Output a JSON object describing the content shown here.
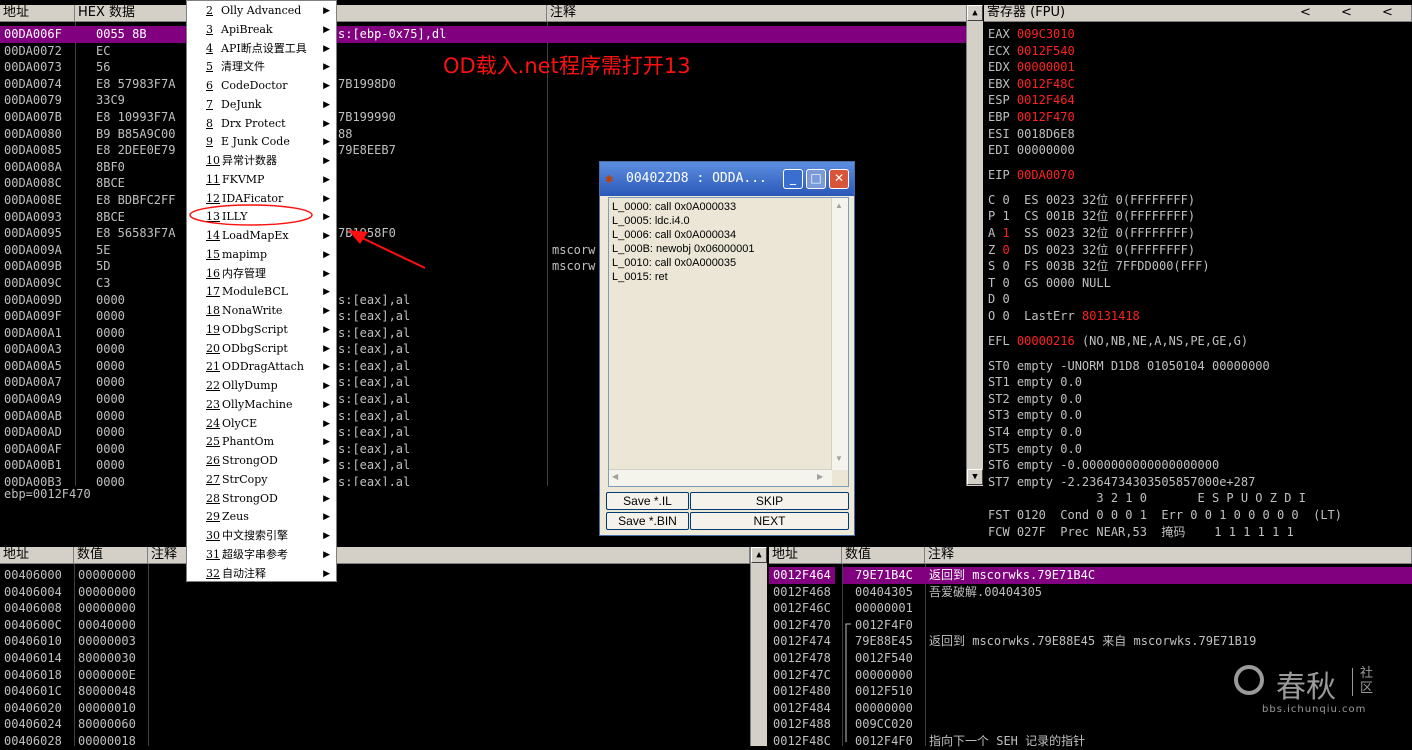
{
  "disasm": {
    "headers": {
      "addr": "地址",
      "hex": "HEX 数据",
      "disasm": "",
      "comment": "注释"
    },
    "rows": [
      {
        "addr": "00DA006F",
        "hex": "0055 8B",
        "asm": "s:[ebp-0x75],dl",
        "cmt": "",
        "sel": true
      },
      {
        "addr": "00DA0072",
        "hex": "EC",
        "asm": "",
        "cmt": ""
      },
      {
        "addr": "00DA0073",
        "hex": "56",
        "asm": "",
        "cmt": ""
      },
      {
        "addr": "00DA0074",
        "hex": "E8 57983F7A",
        "asm": "7B1998D0",
        "cmt": ""
      },
      {
        "addr": "00DA0079",
        "hex": "33C9",
        "asm": "",
        "cmt": ""
      },
      {
        "addr": "00DA007B",
        "hex": "E8 10993F7A",
        "asm": "7B199990",
        "cmt": ""
      },
      {
        "addr": "00DA0080",
        "hex": "B9 B85A9C00",
        "asm": "88",
        "cmt": ""
      },
      {
        "addr": "00DA0085",
        "hex": "E8 2DEE0E79",
        "asm": "79E8EEB7",
        "cmt": ""
      },
      {
        "addr": "00DA008A",
        "hex": "8BF0",
        "asm": "",
        "cmt": ""
      },
      {
        "addr": "00DA008C",
        "hex": "8BCE",
        "asm": "",
        "cmt": ""
      },
      {
        "addr": "00DA008E",
        "hex": "E8 BDBFC2FF",
        "asm": "",
        "cmt": ""
      },
      {
        "addr": "00DA0093",
        "hex": "8BCE",
        "asm": "",
        "cmt": ""
      },
      {
        "addr": "00DA0095",
        "hex": "E8 56583F7A",
        "asm": "7B1958F0",
        "cmt": ""
      },
      {
        "addr": "00DA009A",
        "hex": "5E",
        "asm": "",
        "cmt": "mscorw"
      },
      {
        "addr": "00DA009B",
        "hex": "5D",
        "asm": "",
        "cmt": "mscorw"
      },
      {
        "addr": "00DA009C",
        "hex": "C3",
        "asm": "",
        "cmt": ""
      },
      {
        "addr": "00DA009D",
        "hex": "0000",
        "asm": "s:[eax],al",
        "cmt": ""
      },
      {
        "addr": "00DA009F",
        "hex": "0000",
        "asm": "s:[eax],al",
        "cmt": ""
      },
      {
        "addr": "00DA00A1",
        "hex": "0000",
        "asm": "s:[eax],al",
        "cmt": ""
      },
      {
        "addr": "00DA00A3",
        "hex": "0000",
        "asm": "s:[eax],al",
        "cmt": ""
      },
      {
        "addr": "00DA00A5",
        "hex": "0000",
        "asm": "s:[eax],al",
        "cmt": ""
      },
      {
        "addr": "00DA00A7",
        "hex": "0000",
        "asm": "s:[eax],al",
        "cmt": ""
      },
      {
        "addr": "00DA00A9",
        "hex": "0000",
        "asm": "s:[eax],al",
        "cmt": ""
      },
      {
        "addr": "00DA00AB",
        "hex": "0000",
        "asm": "s:[eax],al",
        "cmt": ""
      },
      {
        "addr": "00DA00AD",
        "hex": "0000",
        "asm": "s:[eax],al",
        "cmt": ""
      },
      {
        "addr": "00DA00AF",
        "hex": "0000",
        "asm": "s:[eax],al",
        "cmt": ""
      },
      {
        "addr": "00DA00B1",
        "hex": "0000",
        "asm": "s:[eax],al",
        "cmt": ""
      },
      {
        "addr": "00DA00B3",
        "hex": "0000",
        "asm": "s:[eax],al",
        "cmt": ""
      }
    ],
    "info_line": "ebp=0012F470"
  },
  "overlay_text": "OD载入.net程序需打开13",
  "menu": {
    "items": [
      {
        "num": "2",
        "label": "Olly Advanced"
      },
      {
        "num": "3",
        "label": "ApiBreak"
      },
      {
        "num": "4",
        "label": "API断点设置工具"
      },
      {
        "num": "5",
        "label": "清理文件"
      },
      {
        "num": "6",
        "label": "CodeDoctor"
      },
      {
        "num": "7",
        "label": "DeJunk"
      },
      {
        "num": "8",
        "label": "Drx Protect"
      },
      {
        "num": "9",
        "label": "E Junk Code"
      },
      {
        "num": "10",
        "label": "异常计数器"
      },
      {
        "num": "11",
        "label": "FKVMP"
      },
      {
        "num": "12",
        "label": "IDAFicator"
      },
      {
        "num": "13",
        "label": "ILLY"
      },
      {
        "num": "14",
        "label": "LoadMapEx"
      },
      {
        "num": "15",
        "label": "mapimp"
      },
      {
        "num": "16",
        "label": "内存管理"
      },
      {
        "num": "17",
        "label": "ModuleBCL"
      },
      {
        "num": "18",
        "label": "NonaWrite"
      },
      {
        "num": "19",
        "label": "ODbgScript"
      },
      {
        "num": "20",
        "label": "ODbgScript"
      },
      {
        "num": "21",
        "label": "ODDragAttach"
      },
      {
        "num": "22",
        "label": "OllyDump"
      },
      {
        "num": "23",
        "label": "OllyMachine"
      },
      {
        "num": "24",
        "label": "OlyCE"
      },
      {
        "num": "25",
        "label": "PhantOm"
      },
      {
        "num": "26",
        "label": "StrongOD"
      },
      {
        "num": "27",
        "label": "StrCopy"
      },
      {
        "num": "28",
        "label": "StrongOD"
      },
      {
        "num": "29",
        "label": "Zeus"
      },
      {
        "num": "30",
        "label": "中文搜索引擎"
      },
      {
        "num": "31",
        "label": "超级字串参考"
      },
      {
        "num": "32",
        "label": "自动注释"
      }
    ],
    "arrow": "▶"
  },
  "registers": {
    "title": "寄存器 (FPU)",
    "nav": [
      "<",
      "<",
      "<"
    ],
    "gp": [
      {
        "name": "EAX",
        "val": "009C3010",
        "red": true
      },
      {
        "name": "ECX",
        "val": "0012F540",
        "red": true
      },
      {
        "name": "EDX",
        "val": "00000001",
        "red": true
      },
      {
        "name": "EBX",
        "val": "0012F48C",
        "red": true
      },
      {
        "name": "ESP",
        "val": "0012F464",
        "red": true
      },
      {
        "name": "EBP",
        "val": "0012F470",
        "red": true
      },
      {
        "name": "ESI",
        "val": "0018D6E8",
        "red": false
      },
      {
        "name": "EDI",
        "val": "00000000",
        "red": false
      }
    ],
    "eip": {
      "name": "EIP",
      "val": "00DA0070"
    },
    "flags": [
      {
        "f": "C",
        "v": "0",
        "seg": "ES 0023 32位 0(FFFFFFFF)",
        "red": false
      },
      {
        "f": "P",
        "v": "1",
        "seg": "CS 001B 32位 0(FFFFFFFF)",
        "red": false
      },
      {
        "f": "A",
        "v": "1",
        "seg": "SS 0023 32位 0(FFFFFFFF)",
        "red": true
      },
      {
        "f": "Z",
        "v": "0",
        "seg": "DS 0023 32位 0(FFFFFFFF)",
        "red": true
      },
      {
        "f": "S",
        "v": "0",
        "seg": "FS 003B 32位 7FFDD000(FFF)",
        "red": false
      },
      {
        "f": "T",
        "v": "0",
        "seg": "GS 0000 NULL",
        "red": false
      },
      {
        "f": "D",
        "v": "0",
        "seg": "",
        "red": false
      },
      {
        "f": "O",
        "v": "0",
        "seg": "LastErr",
        "red": false
      }
    ],
    "lasterr_val": "80131418",
    "efl_label": "EFL",
    "efl_val": "00000216",
    "efl_desc": "(NO,NB,NE,A,NS,PE,GE,G)",
    "st": [
      "ST0 empty -UNORM D1D8 01050104 00000000",
      "ST1 empty 0.0",
      "ST2 empty 0.0",
      "ST3 empty 0.0",
      "ST4 empty 0.0",
      "ST5 empty 0.0",
      "ST6 empty -0.0000000000000000000",
      "ST7 empty -2.2364734303505857000e+287"
    ],
    "bits_header": "               3 2 1 0       E S P U O Z D I",
    "fst": "FST 0120  Cond 0 0 0 1  Err 0 0 1 0 0 0 0 0  (LT)",
    "fcw": "FCW 027F  Prec NEAR,53  掩码    1 1 1 1 1 1"
  },
  "dump": {
    "headers": {
      "addr": "地址",
      "val": "数值",
      "cmt": "注释"
    },
    "rows": [
      {
        "addr": "00406000",
        "val": "00000000"
      },
      {
        "addr": "00406004",
        "val": "00000000"
      },
      {
        "addr": "00406008",
        "val": "00000000"
      },
      {
        "addr": "0040600C",
        "val": "00040000"
      },
      {
        "addr": "00406010",
        "val": "00000003"
      },
      {
        "addr": "00406014",
        "val": "80000030"
      },
      {
        "addr": "00406018",
        "val": "0000000E"
      },
      {
        "addr": "0040601C",
        "val": "80000048"
      },
      {
        "addr": "00406020",
        "val": "00000010"
      },
      {
        "addr": "00406024",
        "val": "80000060"
      },
      {
        "addr": "00406028",
        "val": "00000018"
      }
    ]
  },
  "stack": {
    "headers": {
      "addr": "地址",
      "val": "数值",
      "cmt": "注释"
    },
    "rows": [
      {
        "addr": "0012F464",
        "val": "79E71B4C",
        "cmt": "返回到 mscorwks.79E71B4C",
        "sel": true
      },
      {
        "addr": "0012F468",
        "val": "00404305",
        "cmt": "吾爱破解.00404305"
      },
      {
        "addr": "0012F46C",
        "val": "00000001",
        "cmt": ""
      },
      {
        "addr": "0012F470",
        "val": "0012F4F0",
        "cmt": ""
      },
      {
        "addr": "0012F474",
        "val": "79E88E45",
        "cmt": "返回到 mscorwks.79E88E45 来自 mscorwks.79E71B19"
      },
      {
        "addr": "0012F478",
        "val": "0012F540",
        "cmt": ""
      },
      {
        "addr": "0012F47C",
        "val": "00000000",
        "cmt": ""
      },
      {
        "addr": "0012F480",
        "val": "0012F510",
        "cmt": ""
      },
      {
        "addr": "0012F484",
        "val": "00000000",
        "cmt": ""
      },
      {
        "addr": "0012F488",
        "val": "009CC020",
        "cmt": ""
      },
      {
        "addr": "0012F48C",
        "val": "0012F4F0",
        "cmt": "指向下一个 SEH 记录的指针"
      }
    ]
  },
  "dialog": {
    "title": "004022D8 : ODDA...",
    "min": "_",
    "max": "□",
    "close": "✕",
    "lines": [
      "L_0000: call 0x0A000033",
      "L_0005: ldc.i4.0",
      "L_0006: call 0x0A000034",
      "L_000B: newobj 0x06000001",
      "L_0010: call 0x0A000035",
      "L_0015: ret"
    ],
    "buttons": {
      "save_il": "Save *.IL",
      "skip": "SKIP",
      "save_bin": "Save *.BIN",
      "next": "NEXT"
    }
  },
  "watermark": {
    "brand": "春秋",
    "sub": "社区",
    "url": "bbs.ichunqiu.com"
  },
  "colors": {
    "selected": "#800080",
    "red_value": "#ff2020",
    "annotation": "#ff1010"
  }
}
